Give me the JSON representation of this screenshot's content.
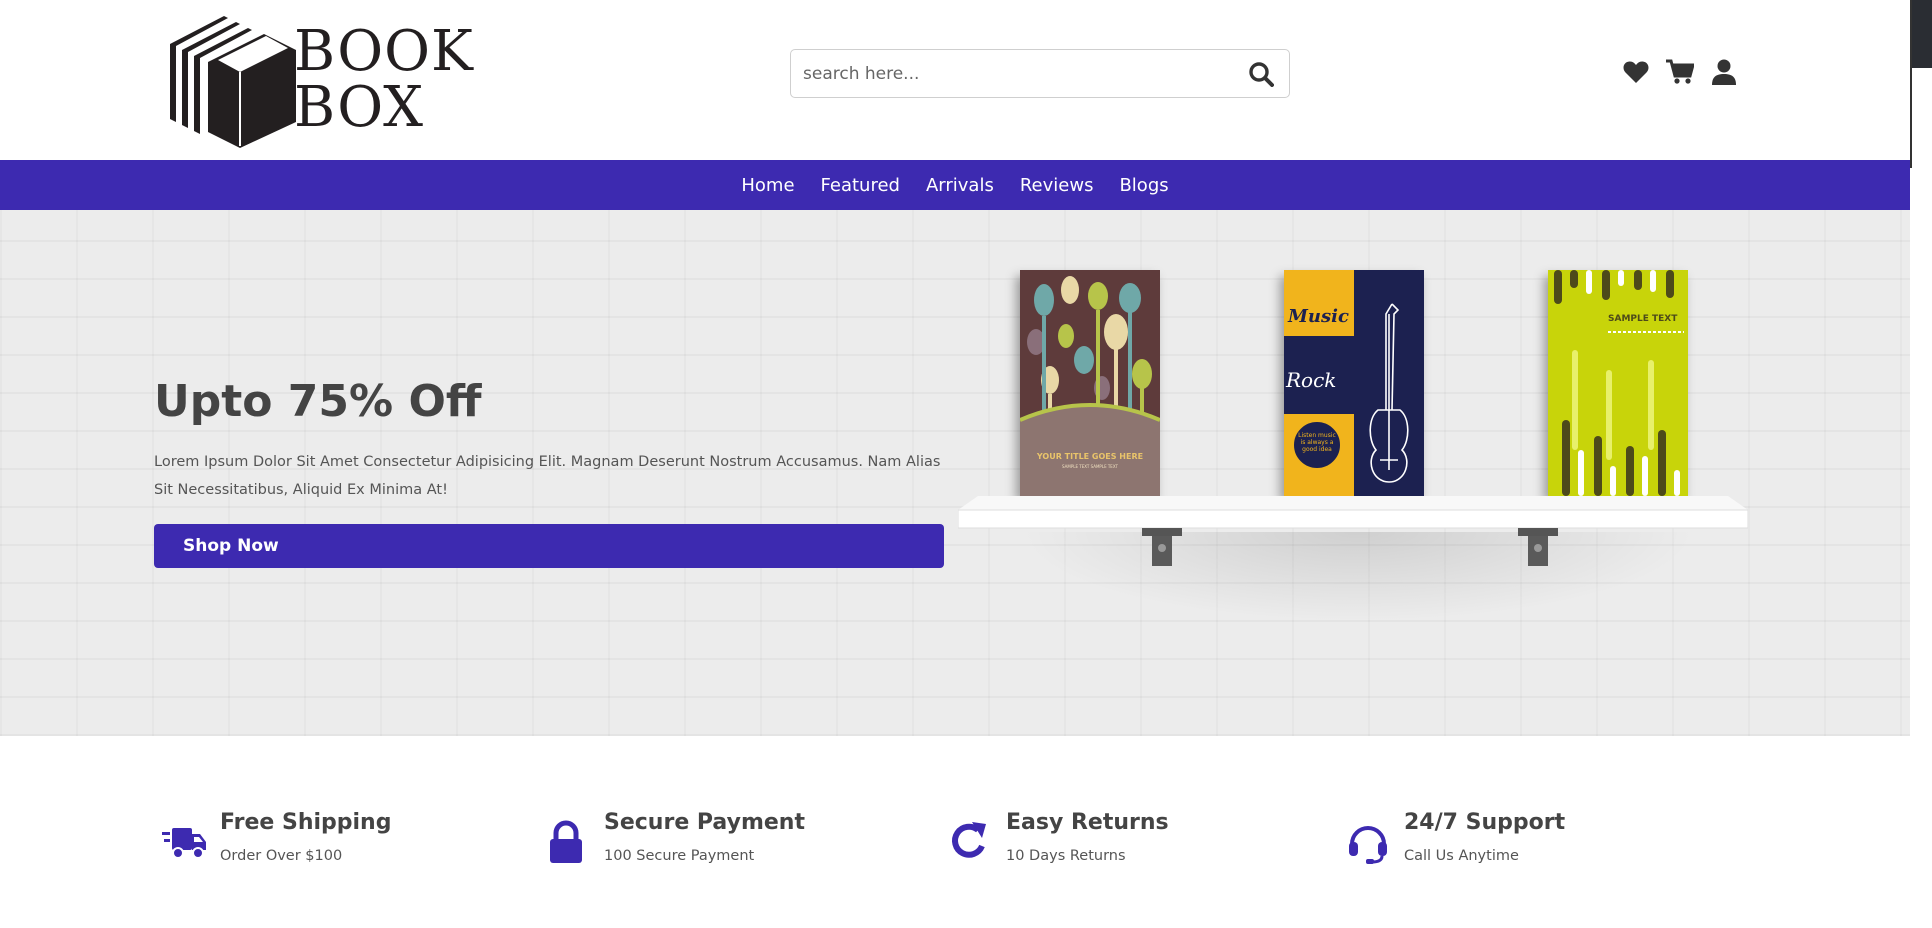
{
  "brand": {
    "line1": "BOOK",
    "line2": "BOX"
  },
  "search": {
    "placeholder": "search here..."
  },
  "header_icons": [
    "heart-icon",
    "cart-icon",
    "user-icon"
  ],
  "nav": {
    "items": [
      {
        "label": "Home"
      },
      {
        "label": "Featured"
      },
      {
        "label": "Arrivals"
      },
      {
        "label": "Reviews"
      },
      {
        "label": "Blogs"
      }
    ]
  },
  "hero": {
    "title": "Upto 75% Off",
    "text": "Lorem Ipsum Dolor Sit Amet Consectetur Adipisicing Elit. Magnam Deserunt Nostrum Accusamus. Nam Alias Sit Necessitatibus, Aliquid Ex Minima At!",
    "button": "Shop Now",
    "books": [
      {
        "caption": "YOUR TITLE GOES HERE",
        "subcaption": "SAMPLE TEXT SAMPLE TEXT"
      },
      {
        "word1": "Music",
        "word2": "Rock",
        "badge": "Listen music is always a good idea"
      },
      {
        "caption": "SAMPLE TEXT"
      }
    ]
  },
  "features": [
    {
      "icon": "truck-icon",
      "title": "Free Shipping",
      "subtitle": "Order Over $100"
    },
    {
      "icon": "lock-icon",
      "title": "Secure Payment",
      "subtitle": "100 Secure Payment"
    },
    {
      "icon": "redo-icon",
      "title": "Easy Returns",
      "subtitle": "10 Days Returns"
    },
    {
      "icon": "headset-icon",
      "title": "24/7 Support",
      "subtitle": "Call Us Anytime"
    }
  ],
  "colors": {
    "accent": "#3d2ab0",
    "text_dark": "#444444",
    "hero_bg": "#ececec"
  }
}
